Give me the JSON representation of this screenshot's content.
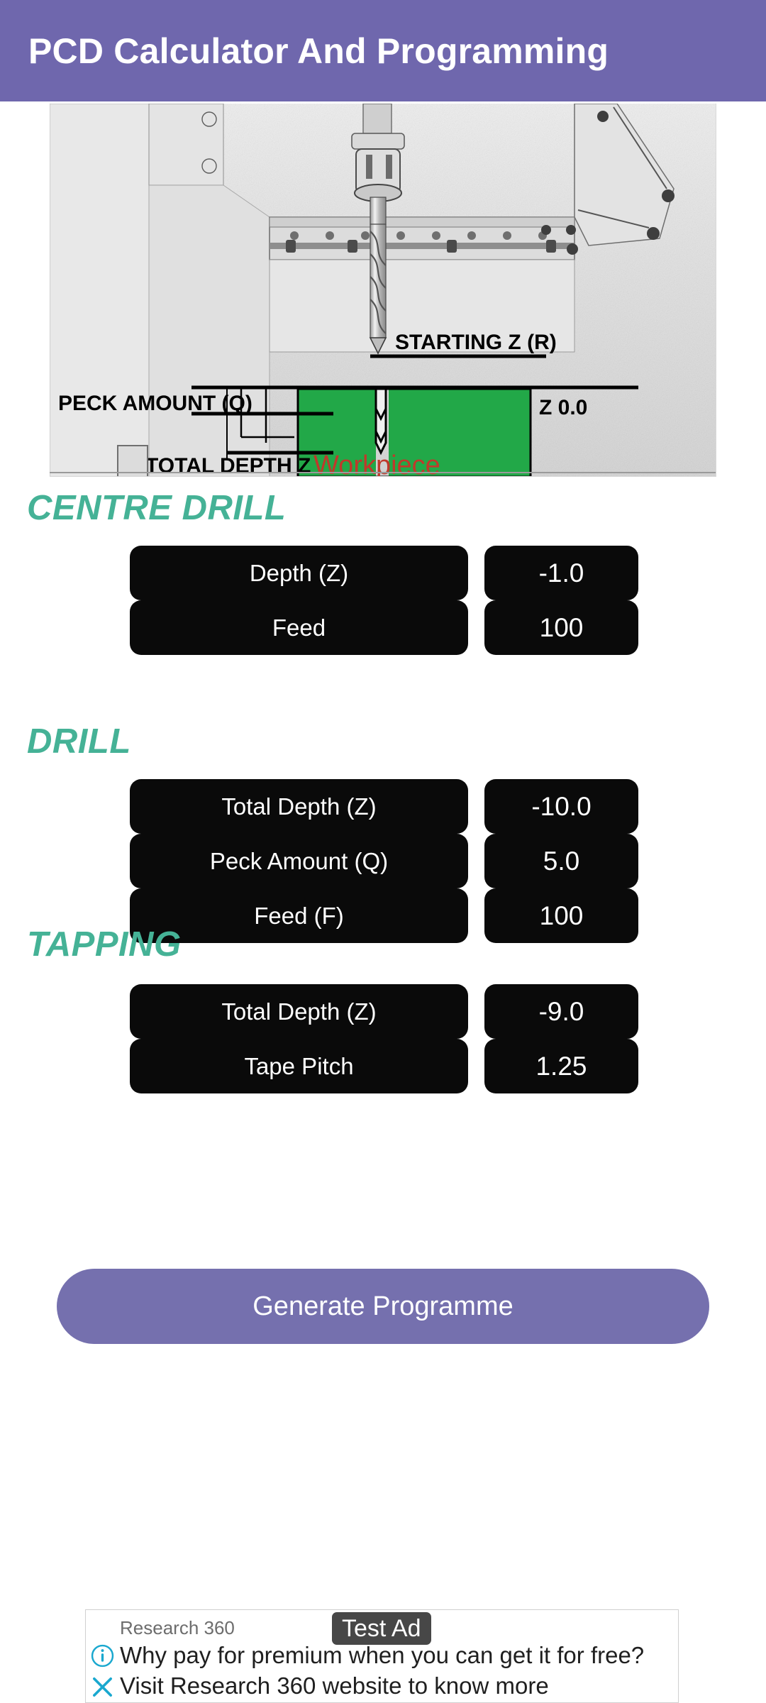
{
  "app": {
    "title": "PCD Calculator And Programming",
    "header_color": "#6f67ad",
    "accent_color": "#45b296",
    "field_bg_color": "#0a0a0a",
    "button_color": "#7570ae"
  },
  "diagram": {
    "alt": "cnc-drilling-depth-diagram",
    "labels": {
      "starting_z": "STARTING Z (R)",
      "z_zero": "Z 0.0",
      "peck_amount": "PECK AMOUNT (Q)",
      "total_depth": "TOTAL DEPTH Z",
      "workpiece": "Workpiece"
    },
    "colors": {
      "workpiece_fill": "#22a848",
      "workpiece_text": "#c0392b",
      "line": "#000000"
    }
  },
  "sections": [
    {
      "id": "centre-drill",
      "heading": "CENTRE DRILL",
      "fields": [
        {
          "label": "Depth (Z)",
          "value": "-1.0"
        },
        {
          "label": "Feed",
          "value": "100"
        }
      ]
    },
    {
      "id": "drill",
      "heading": "DRILL",
      "fields": [
        {
          "label": "Total Depth (Z)",
          "value": "-10.0"
        },
        {
          "label": "Peck Amount (Q)",
          "value": "5.0"
        },
        {
          "label": "Feed (F)",
          "value": "100"
        }
      ]
    },
    {
      "id": "tapping",
      "heading": "TAPPING",
      "fields": [
        {
          "label": "Total Depth (Z)",
          "value": "-9.0"
        },
        {
          "label": "Tape Pitch",
          "value": "1.25"
        }
      ]
    }
  ],
  "actions": {
    "generate_label": "Generate Programme"
  },
  "ad": {
    "badge": "Test Ad",
    "advertiser": "Research 360",
    "headline": "Why pay for premium when you can get it for free?",
    "subline": "Visit Research 360 website to know more",
    "info_icon": "info-circle-icon",
    "close_icon": "close-x-icon",
    "icon_color": "#1aa8cf"
  }
}
